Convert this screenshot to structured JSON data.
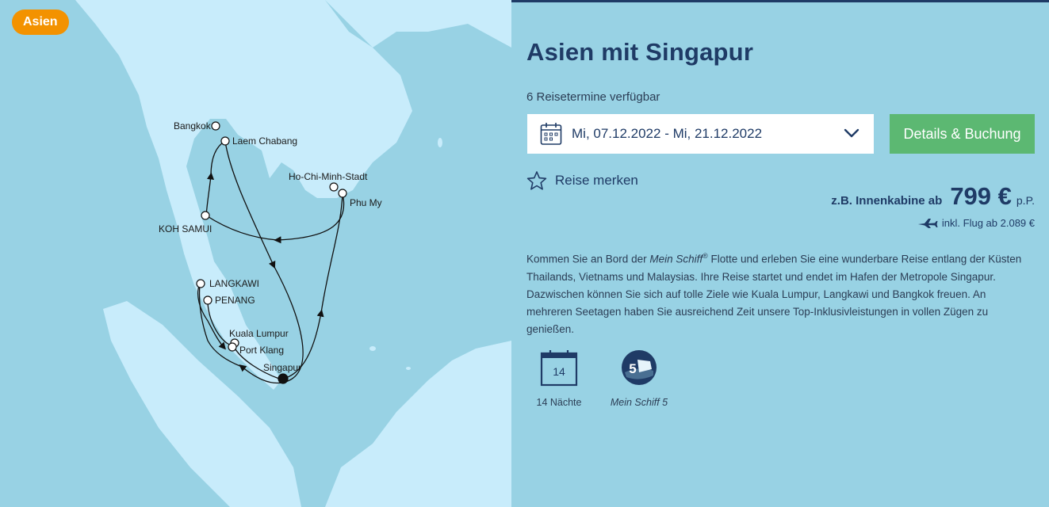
{
  "region_badge": "Asien",
  "map": {
    "ports": [
      {
        "name": "Bangkok"
      },
      {
        "name": "Laem Chabang"
      },
      {
        "name": "Ho-Chi-Minh-Stadt"
      },
      {
        "name": "Phu My"
      },
      {
        "name": "KOH SAMUI"
      },
      {
        "name": "LANGKAWI"
      },
      {
        "name": "PENANG"
      },
      {
        "name": "Kuala Lumpur"
      },
      {
        "name": "Port Klang"
      },
      {
        "name": "Singapur"
      }
    ]
  },
  "trip": {
    "title": "Asien mit Singapur",
    "dates_available": "6 Reisetermine verfügbar",
    "selected_date": "Mi, 07.12.2022 - Mi, 21.12.2022",
    "book_button": "Details & Buchung",
    "bookmark_label": "Reise merken",
    "price_prefix": "z.B. Innenkabine ab",
    "price_amount": "799 €",
    "price_unit": "p.P.",
    "flight_note": "inkl. Flug ab 2.089 €",
    "description": {
      "part1": "Kommen Sie an Bord der ",
      "brand": "Mein Schiff",
      "reg": "®",
      "part2": " Flotte und erleben Sie eine wunderbare Reise entlang der Küsten Thailands, Vietnams und Malaysias. Ihre Reise startet und endet im Hafen der Metropole Singapur. Dazwischen können Sie sich auf tolle Ziele wie Kuala Lumpur, Langkawi und Bangkok freuen. An mehreren Seetagen haben Sie ausreichend Zeit unsere Top-Inklusivleistungen in vollen Zügen zu genießen."
    },
    "features": {
      "nights_number": "14",
      "nights_label": "14 Nächte",
      "ship_number": "5",
      "ship_label": "Mein Schiff 5"
    }
  },
  "colors": {
    "sea": "#98d2e4",
    "land": "#c8ecfb",
    "navy": "#1f3b66",
    "badge": "#f39200",
    "button": "#5cb872"
  }
}
